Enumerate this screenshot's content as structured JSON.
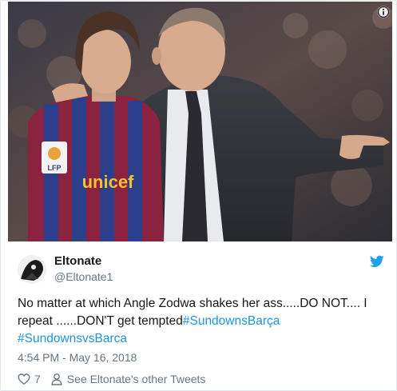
{
  "tweet": {
    "author_name": "Eltonate",
    "author_handle": "@Eltonate1",
    "text_part1": "No matter at which Angle Zodwa shakes her ass.....DO NOT.... I repeat ......DON'T get tempted",
    "hashtag1": "#SundownsBarça",
    "hashtag2": "#SundownsvsBarca",
    "timestamp": "4:54 PM - May 16, 2018",
    "like_count": "7",
    "other_tweets_link": "See Eltonate's other Tweets"
  },
  "media": {
    "jersey_sponsor": "unicef",
    "badge_text": "LFP"
  },
  "icons": {
    "info": "info-icon",
    "brand": "twitter-bird-icon",
    "like": "heart-icon",
    "profile": "person-icon"
  },
  "colors": {
    "link": "#1b95e0",
    "text": "#14171a",
    "secondary": "#657786",
    "border": "#e1e8ed"
  }
}
